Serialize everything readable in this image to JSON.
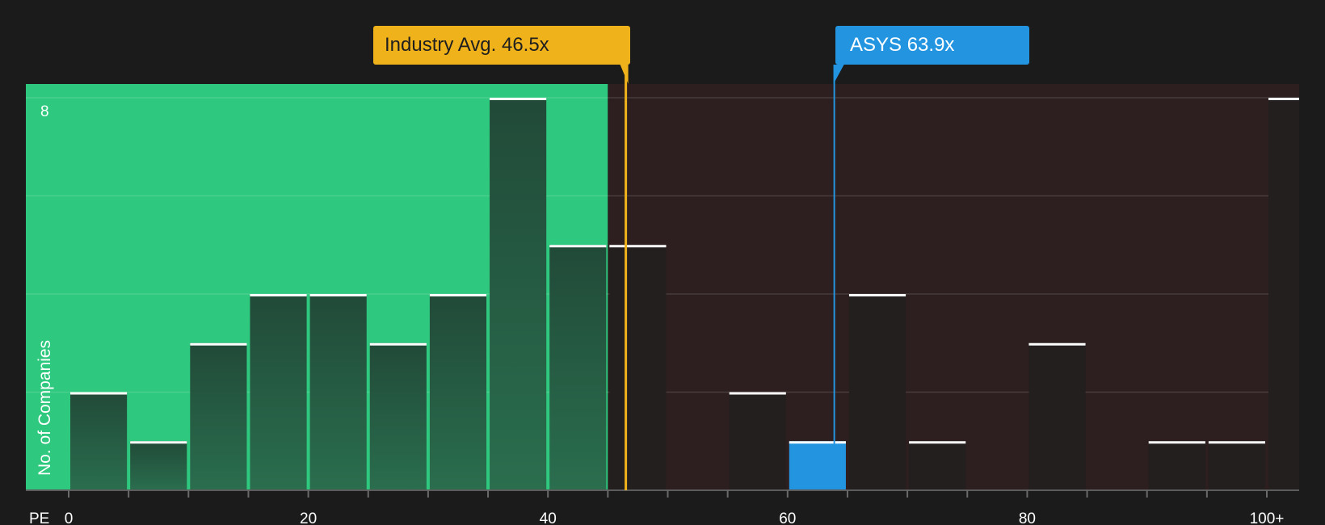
{
  "chart_data": {
    "type": "bar",
    "xlabel": "PE",
    "ylabel": "No. of Companies",
    "x_ticks": [
      "0",
      "20",
      "40",
      "60",
      "80",
      "100+"
    ],
    "y_ticks": [
      "8"
    ],
    "ylim": [
      0,
      8.3
    ],
    "bin_width": 5,
    "bins": [
      {
        "start": 0,
        "count": 2
      },
      {
        "start": 5,
        "count": 1
      },
      {
        "start": 10,
        "count": 3
      },
      {
        "start": 15,
        "count": 4
      },
      {
        "start": 20,
        "count": 4
      },
      {
        "start": 25,
        "count": 3
      },
      {
        "start": 30,
        "count": 4
      },
      {
        "start": 35,
        "count": 8
      },
      {
        "start": 40,
        "count": 5
      },
      {
        "start": 45,
        "count": 5
      },
      {
        "start": 50,
        "count": 0
      },
      {
        "start": 55,
        "count": 2
      },
      {
        "start": 60,
        "count": 1,
        "highlight": true
      },
      {
        "start": 65,
        "count": 4
      },
      {
        "start": 70,
        "count": 1
      },
      {
        "start": 75,
        "count": 0
      },
      {
        "start": 80,
        "count": 3
      },
      {
        "start": 85,
        "count": 0
      },
      {
        "start": 90,
        "count": 1
      },
      {
        "start": 95,
        "count": 1
      },
      {
        "start": 100,
        "count": 8
      }
    ],
    "fair_zone_max": 45,
    "industry_avg": {
      "label": "Industry Avg. 46.5x",
      "value": 46.5
    },
    "company": {
      "label": "ASYS 63.9x",
      "value": 63.9
    },
    "colors": {
      "background": "#1b1b1b",
      "undervalued_zone": "#2ec97e",
      "overvalued_zone": "#2d1f1f",
      "bar_green_zone_top": "#214a38",
      "bar_green_zone_bottom": "#2a6e4e",
      "bar_red_zone": "#221f1e",
      "bar_highlight": "#2394e0",
      "industry_line": "#f0b21b",
      "company_line": "#2394e0"
    }
  }
}
